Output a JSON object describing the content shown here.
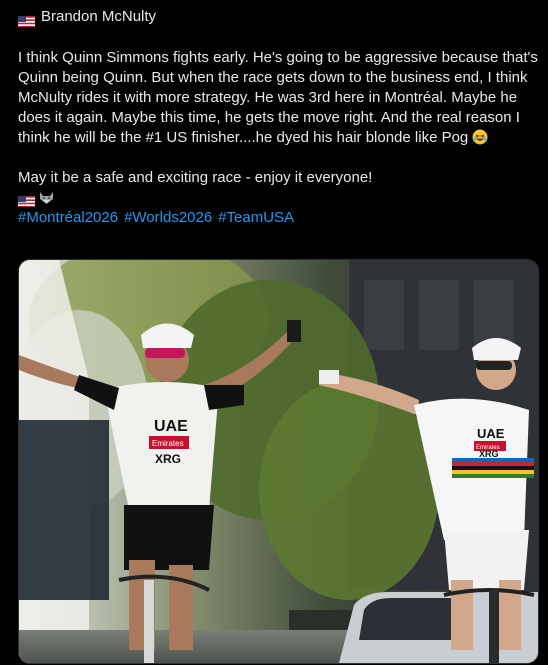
{
  "post": {
    "author": "Brandon McNulty",
    "paragraph1": "I think Quinn Simmons fights early. He's going to be aggressive because that's Quinn being Quinn. But when the race gets down to the business end, I think McNulty rides it with more strategy. He was 3rd here in Montréal. Maybe he does it again. Maybe this time, he gets the move right. And the real reason I think he will be the #1 US finisher....he dyed his hair blonde like Pog",
    "paragraph2": "May it be a safe and exciting race - enjoy it everyone!",
    "hashtags": [
      "#Montréal2026",
      "#Worlds2026",
      "#TeamUSA"
    ],
    "icons": [
      "us-flag-icon",
      "laughing-emoji-icon",
      "us-flag-icon",
      "wolf-emoji-icon"
    ]
  },
  "media": {
    "jersey_text_primary": "UAE",
    "jersey_text_sponsor": "Emirates",
    "jersey_text_secondary": "XRG"
  },
  "colors": {
    "link": "#1d9bf0",
    "text": "#e7e9ea",
    "background": "#000000",
    "border": "#2f3336"
  }
}
